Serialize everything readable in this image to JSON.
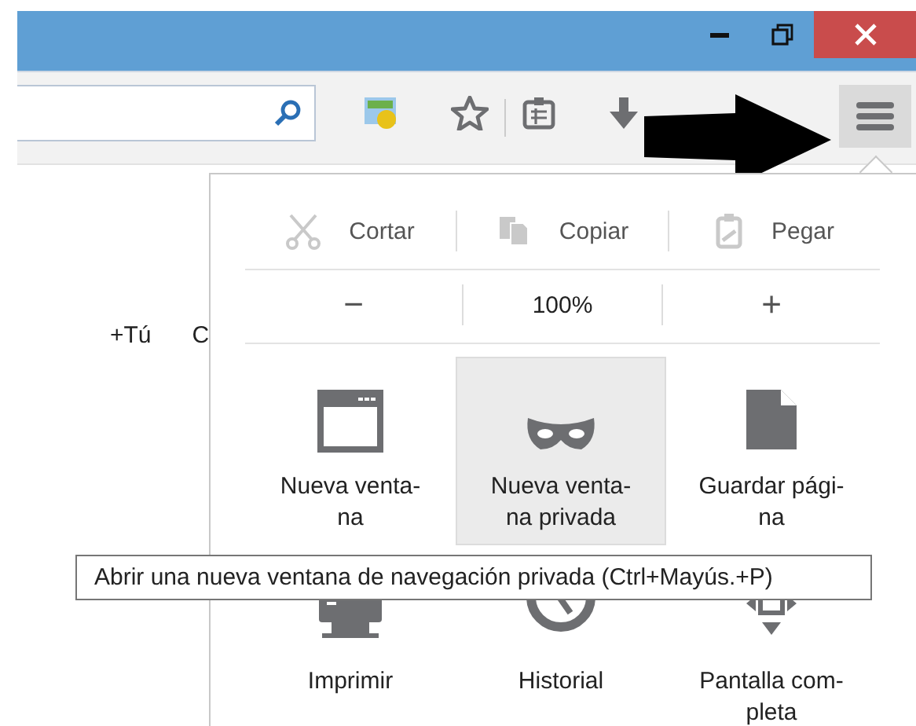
{
  "toolbar": {
    "menu_button": {
      "pressed": true
    }
  },
  "page": {
    "texts": [
      "+Tú",
      "C"
    ]
  },
  "menu": {
    "edit_row": [
      {
        "kind": "cut",
        "label": "Cortar",
        "disabled": true
      },
      {
        "kind": "copy",
        "label": "Copiar",
        "disabled": true
      },
      {
        "kind": "paste",
        "label": "Pegar",
        "disabled": true
      }
    ],
    "zoom_row": {
      "zoom_out": "−",
      "level": "100%",
      "zoom_in": "+"
    },
    "items": [
      {
        "kind": "window",
        "label": "Nueva venta-\nna",
        "selected": false
      },
      {
        "kind": "mask",
        "label": "Nueva venta-\nna privada",
        "selected": true
      },
      {
        "kind": "page",
        "label": "Guardar pági-\nna",
        "selected": false
      },
      {
        "kind": "printer",
        "label": "Imprimir",
        "selected": false
      },
      {
        "kind": "clock",
        "label": "Historial",
        "selected": false
      },
      {
        "kind": "fullscreen",
        "label": "Pantalla com-\npleta",
        "selected": false
      }
    ]
  },
  "tooltip": {
    "text": "Abrir una nueva ventana de navegación privada (Ctrl+Mayús.+P)"
  }
}
